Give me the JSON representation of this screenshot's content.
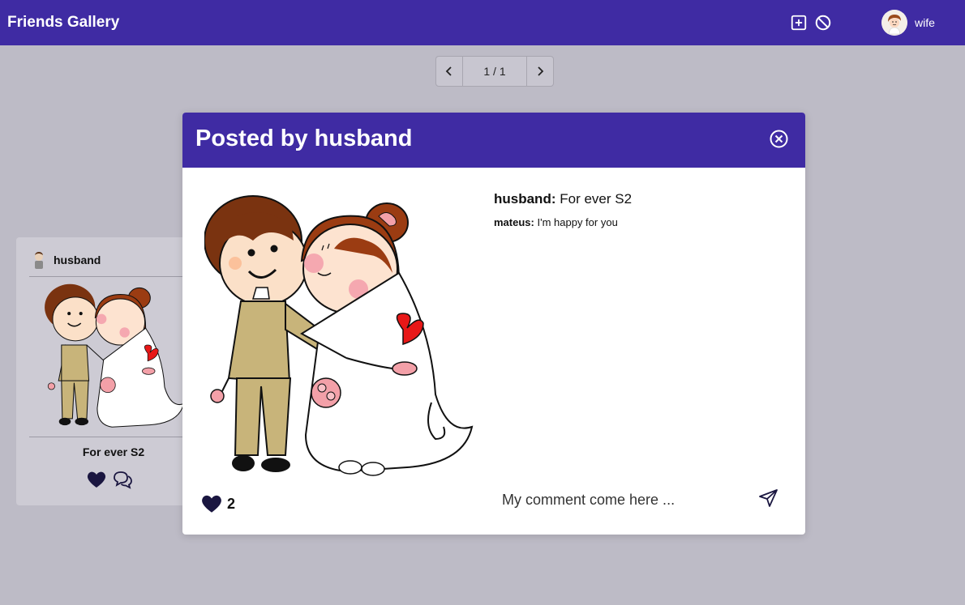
{
  "app": {
    "title": "Friends Gallery"
  },
  "header": {
    "add_icon": "plus-square-icon",
    "block_icon": "ban-icon",
    "user": {
      "name": "wife",
      "avatar_icon": "bride-avatar"
    }
  },
  "pager": {
    "info": "1 / 1",
    "prev_icon": "chevron-left-icon",
    "next_icon": "chevron-right-icon"
  },
  "card": {
    "username": "husband",
    "caption": "For ever S2",
    "like_icon": "heart-icon",
    "comment_icon": "comments-icon"
  },
  "modal": {
    "title": "Posted by husband",
    "close_icon": "close-circle-icon",
    "likes": "2",
    "comments": [
      {
        "author": "husband:",
        "text": "For ever S2"
      },
      {
        "author": "mateus:",
        "text": "I'm happy for you"
      }
    ],
    "comment_input": {
      "value": "My comment come here ...",
      "placeholder": ""
    },
    "send_icon": "send-icon"
  },
  "colors": {
    "primary": "#3f2ba3",
    "backdrop": "#bdbbc6",
    "heart": "#1a1640"
  }
}
